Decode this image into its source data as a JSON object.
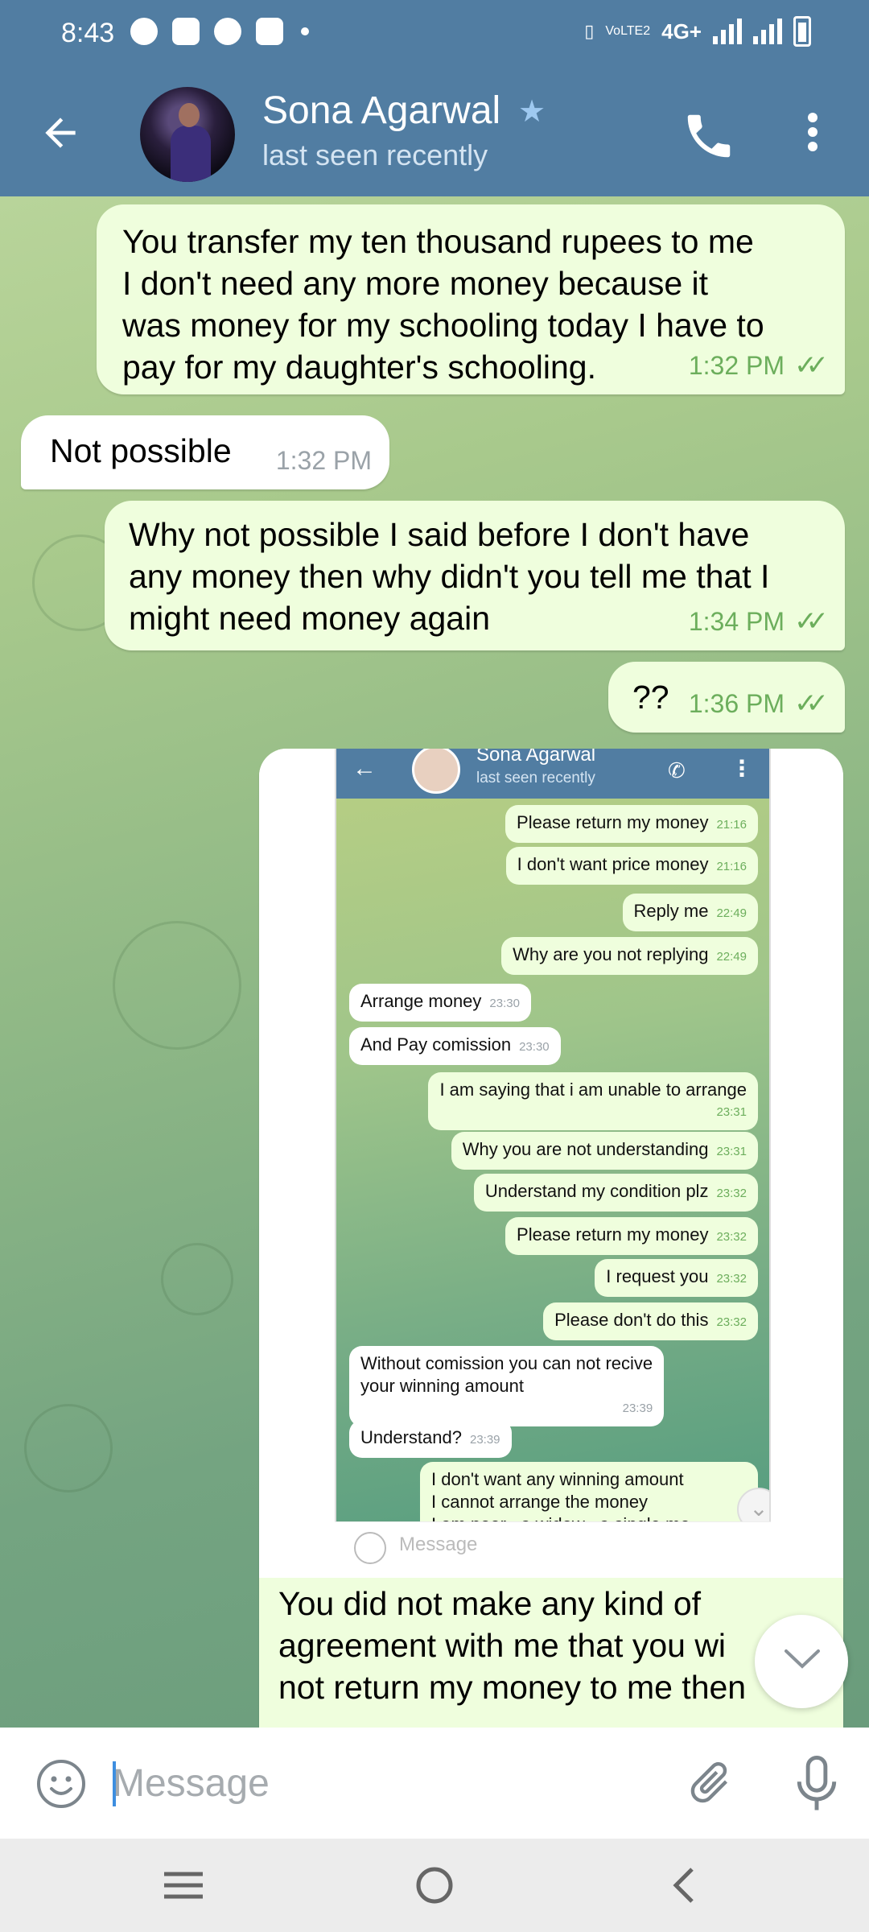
{
  "status_bar": {
    "time": "8:43",
    "network": "4G+",
    "volte": "VoLTE2"
  },
  "header": {
    "contact_name": "Sona Agarwal",
    "contact_status": "last seen recently",
    "star_icon": "star-icon",
    "call_icon": "phone-icon",
    "more_icon": "more-vert-icon"
  },
  "messages": [
    {
      "direction": "out",
      "text": "You transfer my ten thousand rupees to me\nI don't need any more money because it\nwas money for my schooling today I have to\npay for my daughter's schooling.",
      "time": "1:32 PM",
      "ticks": "✓✓"
    },
    {
      "direction": "in",
      "text": "Not possible",
      "time": "1:32 PM"
    },
    {
      "direction": "out",
      "text": "Why not possible I said before I don't have\nany money then why didn't you tell me that I\nmight need money again",
      "time": "1:34 PM",
      "ticks": "✓✓"
    },
    {
      "direction": "out",
      "text": "??",
      "time": "1:36 PM",
      "ticks": "✓✓"
    }
  ],
  "photo": {
    "header_name": "Sona Agarwal",
    "header_status": "last seen recently",
    "messages": [
      {
        "d": "o",
        "text": "Please return my money",
        "time": "21:16"
      },
      {
        "d": "o",
        "text": "I don't want price money",
        "time": "21:16"
      },
      {
        "d": "o",
        "text": "Reply me",
        "time": "22:49"
      },
      {
        "d": "o",
        "text": "Why are you not replying",
        "time": "22:49"
      },
      {
        "d": "i",
        "text": "Arrange money",
        "time": "23:30"
      },
      {
        "d": "i",
        "text": "And Pay comission",
        "time": "23:30"
      },
      {
        "d": "o",
        "text": "I am saying that i am unable to arrange",
        "time": "23:31"
      },
      {
        "d": "o",
        "text": "Why you are not understanding",
        "time": "23:31"
      },
      {
        "d": "o",
        "text": "Understand my condition plz",
        "time": "23:32"
      },
      {
        "d": "o",
        "text": "Please return my money",
        "time": "23:32"
      },
      {
        "d": "o",
        "text": "I request you",
        "time": "23:32"
      },
      {
        "d": "o",
        "text": "Please don't do this",
        "time": "23:32"
      },
      {
        "d": "i",
        "text": "Without comission you can not recive\nyour winning amount",
        "time": "23:39"
      },
      {
        "d": "i",
        "text": "Understand?",
        "time": "23:39"
      },
      {
        "d": "o",
        "text": "I don't want any winning amount\nI cannot arrange the money\nI am poor , a widow , a single mo",
        "time": ""
      }
    ],
    "input_placeholder": "Message",
    "caption": "You did not make any kind of\nagreement with me that you wi\nnot return my money to me then"
  },
  "input": {
    "placeholder": "Message",
    "value": ""
  },
  "colors": {
    "header": "#517da2",
    "outgoing_bubble": "#effedd",
    "incoming_bubble": "#ffffff",
    "tick_green": "#6cae5c",
    "accent_blue": "#3d8ee0"
  }
}
